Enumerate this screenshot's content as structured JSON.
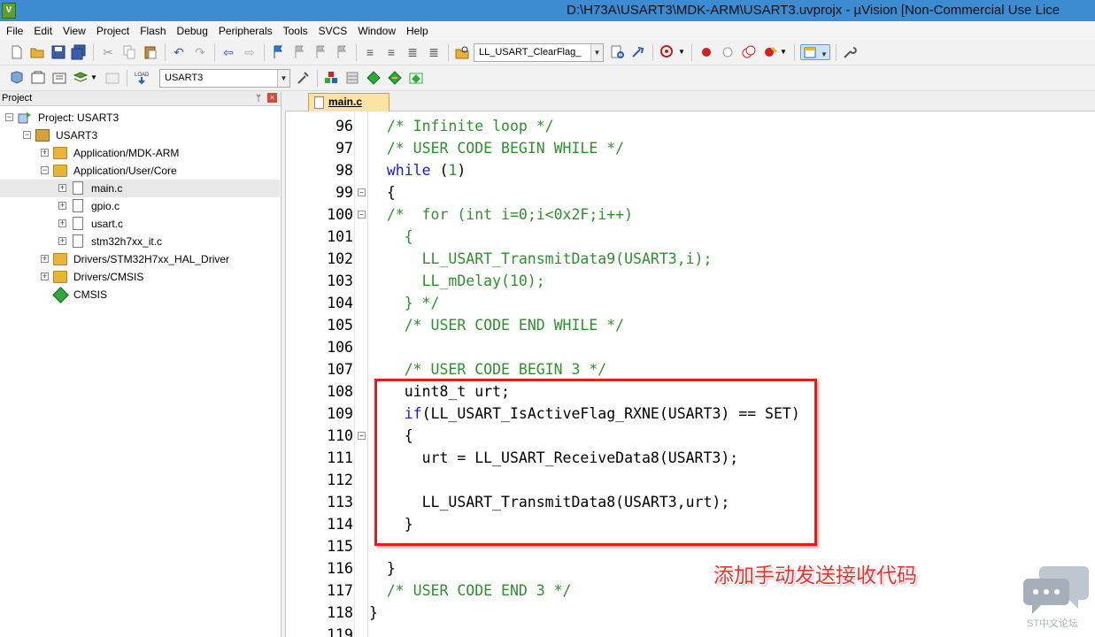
{
  "window": {
    "title": "D:\\H73A\\USART3\\MDK-ARM\\USART3.uvprojx - µVision  [Non-Commercial Use Lice",
    "app_icon_letter": "V"
  },
  "menu": [
    "File",
    "Edit",
    "View",
    "Project",
    "Flash",
    "Debug",
    "Peripherals",
    "Tools",
    "SVCS",
    "Window",
    "Help"
  ],
  "toolbar": {
    "find_combo_value": "LL_USART_ClearFlag_",
    "target_combo_value": "USART3"
  },
  "project_panel": {
    "header": "Project",
    "pin": "ᛘ",
    "close": "×",
    "tree": [
      {
        "label": "Project: USART3",
        "icon": "project-icon",
        "expander": "−"
      },
      {
        "label": "USART3",
        "icon": "target-icon",
        "expander": "−"
      },
      {
        "label": "Application/MDK-ARM",
        "icon": "folder-icon",
        "expander": "+"
      },
      {
        "label": "Application/User/Core",
        "icon": "folder-icon",
        "expander": "−"
      },
      {
        "label": "main.c",
        "icon": "file-icon",
        "expander": "+"
      },
      {
        "label": "gpio.c",
        "icon": "file-icon",
        "expander": "+"
      },
      {
        "label": "usart.c",
        "icon": "file-icon",
        "expander": "+"
      },
      {
        "label": "stm32h7xx_it.c",
        "icon": "file-icon",
        "expander": "+"
      },
      {
        "label": "Drivers/STM32H7xx_HAL_Driver",
        "icon": "folder-icon",
        "expander": "+"
      },
      {
        "label": "Drivers/CMSIS",
        "icon": "folder-icon",
        "expander": "+"
      },
      {
        "label": "CMSIS",
        "icon": "cmsis-icon",
        "expander": ""
      }
    ]
  },
  "editor": {
    "active_tab": "main.c",
    "lines": [
      {
        "num": "96",
        "fold": "",
        "segments": [
          {
            "t": "  ",
            "c": "c-normal"
          },
          {
            "t": "/* Infinite loop */",
            "c": "c-comment"
          }
        ]
      },
      {
        "num": "97",
        "fold": "",
        "segments": [
          {
            "t": "  ",
            "c": "c-normal"
          },
          {
            "t": "/* USER CODE BEGIN WHILE */",
            "c": "c-comment"
          }
        ]
      },
      {
        "num": "98",
        "fold": "",
        "segments": [
          {
            "t": "  ",
            "c": "c-normal"
          },
          {
            "t": "while",
            "c": "c-keyword"
          },
          {
            "t": " (",
            "c": "c-normal"
          },
          {
            "t": "1",
            "c": "c-comment"
          },
          {
            "t": ")",
            "c": "c-normal"
          }
        ]
      },
      {
        "num": "99",
        "fold": "−",
        "segments": [
          {
            "t": "  {",
            "c": "c-normal"
          }
        ]
      },
      {
        "num": "100",
        "fold": "−",
        "segments": [
          {
            "t": "  ",
            "c": "c-normal"
          },
          {
            "t": "/*  for (int i=0;i<0x2F;i++)",
            "c": "c-comment"
          }
        ]
      },
      {
        "num": "101",
        "fold": "",
        "segments": [
          {
            "t": "    {",
            "c": "c-comment"
          }
        ]
      },
      {
        "num": "102",
        "fold": "",
        "segments": [
          {
            "t": "      LL_USART_TransmitData9(USART3,i);",
            "c": "c-comment"
          }
        ]
      },
      {
        "num": "103",
        "fold": "",
        "segments": [
          {
            "t": "      LL_mDelay(10);",
            "c": "c-comment"
          }
        ]
      },
      {
        "num": "104",
        "fold": "",
        "segments": [
          {
            "t": "    } */",
            "c": "c-comment"
          }
        ]
      },
      {
        "num": "105",
        "fold": "",
        "segments": [
          {
            "t": "    ",
            "c": "c-normal"
          },
          {
            "t": "/* USER CODE END WHILE */",
            "c": "c-comment"
          }
        ]
      },
      {
        "num": "106",
        "fold": "",
        "segments": [
          {
            "t": "",
            "c": "c-normal"
          }
        ]
      },
      {
        "num": "107",
        "fold": "",
        "segments": [
          {
            "t": "    ",
            "c": "c-normal"
          },
          {
            "t": "/* USER CODE BEGIN 3 */",
            "c": "c-comment"
          }
        ]
      },
      {
        "num": "108",
        "fold": "",
        "segments": [
          {
            "t": "    uint8_t urt;",
            "c": "c-normal"
          }
        ]
      },
      {
        "num": "109",
        "fold": "",
        "segments": [
          {
            "t": "    ",
            "c": "c-normal"
          },
          {
            "t": "if",
            "c": "c-keyword"
          },
          {
            "t": "(LL_USART_IsActiveFlag_RXNE(USART3) == SET)",
            "c": "c-normal"
          }
        ]
      },
      {
        "num": "110",
        "fold": "−",
        "segments": [
          {
            "t": "    {",
            "c": "c-normal"
          }
        ]
      },
      {
        "num": "111",
        "fold": "",
        "segments": [
          {
            "t": "      urt = LL_USART_ReceiveData8(USART3);",
            "c": "c-normal"
          }
        ]
      },
      {
        "num": "112",
        "fold": "",
        "segments": [
          {
            "t": "",
            "c": "c-normal"
          }
        ]
      },
      {
        "num": "113",
        "fold": "",
        "segments": [
          {
            "t": "      LL_USART_TransmitData8(USART3,urt);",
            "c": "c-normal"
          }
        ]
      },
      {
        "num": "114",
        "fold": "",
        "segments": [
          {
            "t": "    }",
            "c": "c-normal"
          }
        ]
      },
      {
        "num": "115",
        "fold": "",
        "segments": [
          {
            "t": "",
            "c": "c-normal"
          }
        ]
      },
      {
        "num": "116",
        "fold": "",
        "segments": [
          {
            "t": "  }",
            "c": "c-normal"
          }
        ]
      },
      {
        "num": "117",
        "fold": "",
        "segments": [
          {
            "t": "  ",
            "c": "c-normal"
          },
          {
            "t": "/* USER CODE END 3 */",
            "c": "c-comment"
          }
        ]
      },
      {
        "num": "118",
        "fold": "",
        "segments": [
          {
            "t": "}",
            "c": "c-normal"
          }
        ]
      },
      {
        "num": "119",
        "fold": "",
        "segments": [
          {
            "t": "",
            "c": "c-normal"
          }
        ]
      }
    ]
  },
  "annotation": "添加手动发送接收代码",
  "watermark": "ST中文论坛",
  "colors": {
    "comment": "#2f8f2f",
    "keyword": "#1a1ad6",
    "highlight": "#e02020",
    "titlebar": "#3d8bd1"
  }
}
